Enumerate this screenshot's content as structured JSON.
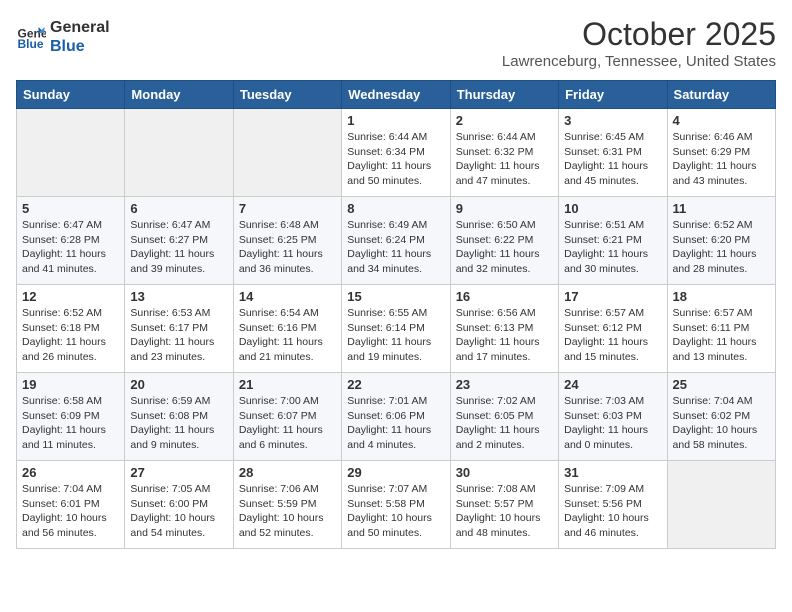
{
  "header": {
    "logo_line1": "General",
    "logo_line2": "Blue",
    "month": "October 2025",
    "location": "Lawrenceburg, Tennessee, United States"
  },
  "weekdays": [
    "Sunday",
    "Monday",
    "Tuesday",
    "Wednesday",
    "Thursday",
    "Friday",
    "Saturday"
  ],
  "weeks": [
    [
      {
        "day": "",
        "info": ""
      },
      {
        "day": "",
        "info": ""
      },
      {
        "day": "",
        "info": ""
      },
      {
        "day": "1",
        "info": "Sunrise: 6:44 AM\nSunset: 6:34 PM\nDaylight: 11 hours\nand 50 minutes."
      },
      {
        "day": "2",
        "info": "Sunrise: 6:44 AM\nSunset: 6:32 PM\nDaylight: 11 hours\nand 47 minutes."
      },
      {
        "day": "3",
        "info": "Sunrise: 6:45 AM\nSunset: 6:31 PM\nDaylight: 11 hours\nand 45 minutes."
      },
      {
        "day": "4",
        "info": "Sunrise: 6:46 AM\nSunset: 6:29 PM\nDaylight: 11 hours\nand 43 minutes."
      }
    ],
    [
      {
        "day": "5",
        "info": "Sunrise: 6:47 AM\nSunset: 6:28 PM\nDaylight: 11 hours\nand 41 minutes."
      },
      {
        "day": "6",
        "info": "Sunrise: 6:47 AM\nSunset: 6:27 PM\nDaylight: 11 hours\nand 39 minutes."
      },
      {
        "day": "7",
        "info": "Sunrise: 6:48 AM\nSunset: 6:25 PM\nDaylight: 11 hours\nand 36 minutes."
      },
      {
        "day": "8",
        "info": "Sunrise: 6:49 AM\nSunset: 6:24 PM\nDaylight: 11 hours\nand 34 minutes."
      },
      {
        "day": "9",
        "info": "Sunrise: 6:50 AM\nSunset: 6:22 PM\nDaylight: 11 hours\nand 32 minutes."
      },
      {
        "day": "10",
        "info": "Sunrise: 6:51 AM\nSunset: 6:21 PM\nDaylight: 11 hours\nand 30 minutes."
      },
      {
        "day": "11",
        "info": "Sunrise: 6:52 AM\nSunset: 6:20 PM\nDaylight: 11 hours\nand 28 minutes."
      }
    ],
    [
      {
        "day": "12",
        "info": "Sunrise: 6:52 AM\nSunset: 6:18 PM\nDaylight: 11 hours\nand 26 minutes."
      },
      {
        "day": "13",
        "info": "Sunrise: 6:53 AM\nSunset: 6:17 PM\nDaylight: 11 hours\nand 23 minutes."
      },
      {
        "day": "14",
        "info": "Sunrise: 6:54 AM\nSunset: 6:16 PM\nDaylight: 11 hours\nand 21 minutes."
      },
      {
        "day": "15",
        "info": "Sunrise: 6:55 AM\nSunset: 6:14 PM\nDaylight: 11 hours\nand 19 minutes."
      },
      {
        "day": "16",
        "info": "Sunrise: 6:56 AM\nSunset: 6:13 PM\nDaylight: 11 hours\nand 17 minutes."
      },
      {
        "day": "17",
        "info": "Sunrise: 6:57 AM\nSunset: 6:12 PM\nDaylight: 11 hours\nand 15 minutes."
      },
      {
        "day": "18",
        "info": "Sunrise: 6:57 AM\nSunset: 6:11 PM\nDaylight: 11 hours\nand 13 minutes."
      }
    ],
    [
      {
        "day": "19",
        "info": "Sunrise: 6:58 AM\nSunset: 6:09 PM\nDaylight: 11 hours\nand 11 minutes."
      },
      {
        "day": "20",
        "info": "Sunrise: 6:59 AM\nSunset: 6:08 PM\nDaylight: 11 hours\nand 9 minutes."
      },
      {
        "day": "21",
        "info": "Sunrise: 7:00 AM\nSunset: 6:07 PM\nDaylight: 11 hours\nand 6 minutes."
      },
      {
        "day": "22",
        "info": "Sunrise: 7:01 AM\nSunset: 6:06 PM\nDaylight: 11 hours\nand 4 minutes."
      },
      {
        "day": "23",
        "info": "Sunrise: 7:02 AM\nSunset: 6:05 PM\nDaylight: 11 hours\nand 2 minutes."
      },
      {
        "day": "24",
        "info": "Sunrise: 7:03 AM\nSunset: 6:03 PM\nDaylight: 11 hours\nand 0 minutes."
      },
      {
        "day": "25",
        "info": "Sunrise: 7:04 AM\nSunset: 6:02 PM\nDaylight: 10 hours\nand 58 minutes."
      }
    ],
    [
      {
        "day": "26",
        "info": "Sunrise: 7:04 AM\nSunset: 6:01 PM\nDaylight: 10 hours\nand 56 minutes."
      },
      {
        "day": "27",
        "info": "Sunrise: 7:05 AM\nSunset: 6:00 PM\nDaylight: 10 hours\nand 54 minutes."
      },
      {
        "day": "28",
        "info": "Sunrise: 7:06 AM\nSunset: 5:59 PM\nDaylight: 10 hours\nand 52 minutes."
      },
      {
        "day": "29",
        "info": "Sunrise: 7:07 AM\nSunset: 5:58 PM\nDaylight: 10 hours\nand 50 minutes."
      },
      {
        "day": "30",
        "info": "Sunrise: 7:08 AM\nSunset: 5:57 PM\nDaylight: 10 hours\nand 48 minutes."
      },
      {
        "day": "31",
        "info": "Sunrise: 7:09 AM\nSunset: 5:56 PM\nDaylight: 10 hours\nand 46 minutes."
      },
      {
        "day": "",
        "info": ""
      }
    ]
  ]
}
